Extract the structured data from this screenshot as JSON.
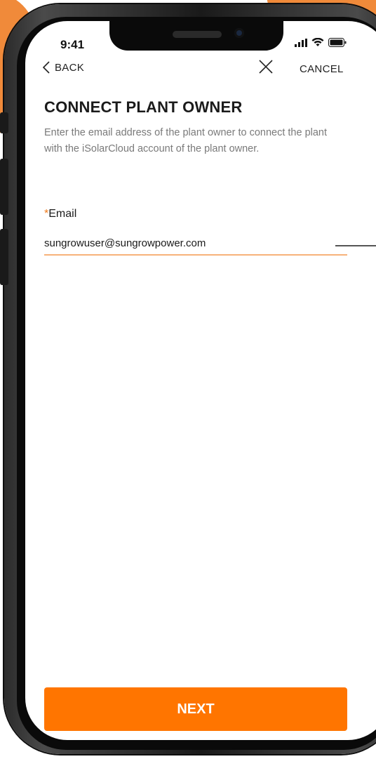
{
  "status_bar": {
    "time": "9:41",
    "icons": [
      "signal-icon",
      "wifi-icon",
      "battery-icon"
    ]
  },
  "nav": {
    "back_label": "BACK",
    "cancel_label": "CANCEL"
  },
  "page": {
    "title": "CONNECT PLANT OWNER",
    "description": "Enter the email address of the plant owner to connect the plant with the iSolarCloud account of the plant owner."
  },
  "form": {
    "email_required_marker": "*",
    "email_label": "Email",
    "email_value": "sungrowuser@sungrowpower.com"
  },
  "actions": {
    "next_label": "NEXT"
  },
  "colors": {
    "accent": "#ff7500",
    "input_underline": "#f7b27a",
    "background_accent": "#f08a3a"
  }
}
